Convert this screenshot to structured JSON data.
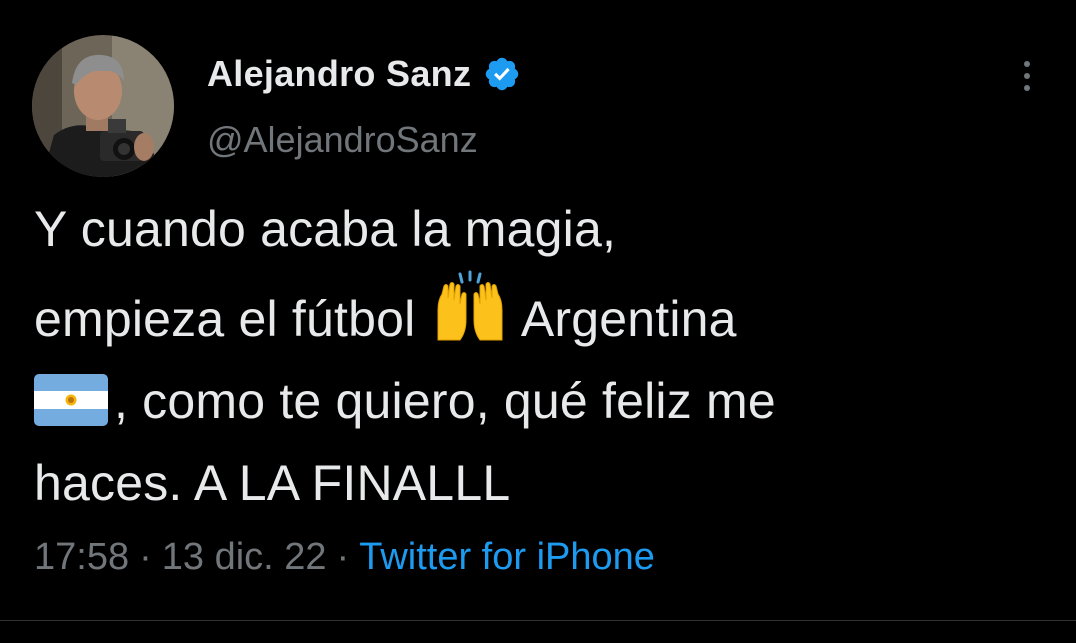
{
  "author": {
    "display_name": "Alejandro Sanz",
    "handle": "@AlejandroSanz",
    "verified": true,
    "avatar_icon": "profile-photo-man-with-camera"
  },
  "tweet": {
    "line1": "Y cuando acaba la magia,",
    "line2_before": "empieza el fútbol ",
    "line2_emoji": "raising-hands-icon",
    "line2_after": " Argentina",
    "line3_emoji": "argentina-flag-icon",
    "line3_after": ", como te quiero, qué feliz me",
    "line4": "haces. A LA FINALLL"
  },
  "meta": {
    "time": "17:58",
    "separator": "·",
    "date": "13 dic. 22",
    "source": "Twitter for iPhone"
  },
  "colors": {
    "background": "#000000",
    "text": "#e7e9ea",
    "secondary": "#71767b",
    "link": "#1d9bf0",
    "verified": "#1d9bf0"
  }
}
